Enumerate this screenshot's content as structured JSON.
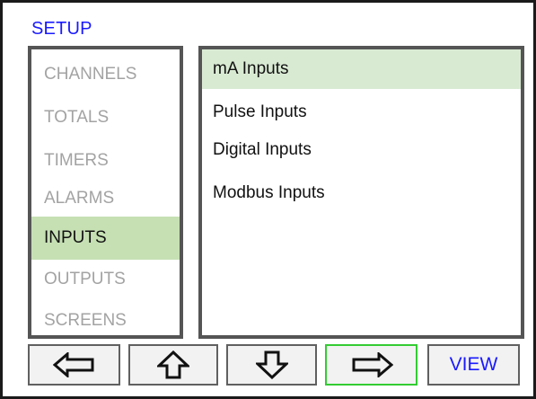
{
  "title": "SETUP",
  "menu": {
    "items": [
      {
        "label": "CHANNELS",
        "active": false
      },
      {
        "label": "TOTALS",
        "active": false
      },
      {
        "label": "TIMERS",
        "active": false
      },
      {
        "label": "ALARMS",
        "active": false
      },
      {
        "label": "INPUTS",
        "active": true
      },
      {
        "label": "OUTPUTS",
        "active": false
      },
      {
        "label": "SCREENS",
        "active": false
      }
    ]
  },
  "options": {
    "items": [
      {
        "label": "mA Inputs",
        "selected": true
      },
      {
        "label": "Pulse Inputs",
        "selected": false
      },
      {
        "label": "Digital Inputs",
        "selected": false
      },
      {
        "label": "Modbus Inputs",
        "selected": false
      }
    ]
  },
  "buttons": {
    "left": {
      "icon": "arrow-left-icon"
    },
    "up": {
      "icon": "arrow-up-icon"
    },
    "down": {
      "icon": "arrow-down-icon"
    },
    "right": {
      "icon": "arrow-right-icon",
      "focused": true
    },
    "view": {
      "label": "VIEW"
    }
  },
  "colors": {
    "title": "#1a1aff",
    "menu_highlight": "#c6e0b4",
    "option_highlight": "#d9ead3",
    "focus_border": "#33cc33",
    "inactive_text": "#a3a3a3"
  }
}
